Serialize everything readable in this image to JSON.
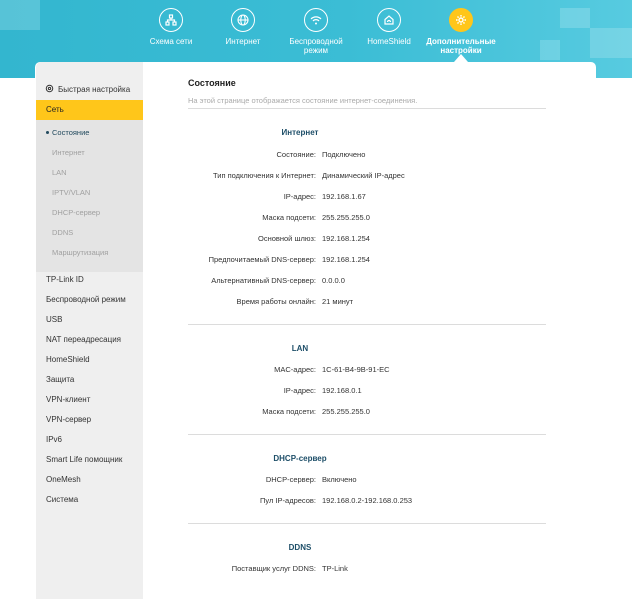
{
  "topnav": {
    "items": [
      {
        "label": "Схема сети",
        "icon": "network-map-icon"
      },
      {
        "label": "Интернет",
        "icon": "globe-icon"
      },
      {
        "label": "Беспроводной режим",
        "icon": "wifi-icon"
      },
      {
        "label": "HomeShield",
        "icon": "homeshield-icon"
      },
      {
        "label": "Дополнительные настройки",
        "icon": "gear-icon"
      }
    ],
    "active_index": 4
  },
  "sidebar": {
    "quick_setup": "Быстрая настройка",
    "network": "Сеть",
    "network_sub": [
      "Состояние",
      "Интернет",
      "LAN",
      "IPTV/VLAN",
      "DHCP-сервер",
      "DDNS",
      "Маршрутизация"
    ],
    "items": [
      "TP-Link ID",
      "Беспроводной режим",
      "USB",
      "NAT переадресация",
      "HomeShield",
      "Защита",
      "VPN-клиент",
      "VPN-сервер",
      "IPv6",
      "Smart Life помощник",
      "OneMesh",
      "Система"
    ]
  },
  "main": {
    "title": "Состояние",
    "description": "На этой странице отображается состояние интернет-соединения.",
    "internet": {
      "title": "Интернет",
      "rows": [
        {
          "label": "Состояние:",
          "value": "Подключено"
        },
        {
          "label": "Тип подключения к Интернет:",
          "value": "Динамический IP-адрес"
        },
        {
          "label": "IP-адрес:",
          "value": "192.168.1.67"
        },
        {
          "label": "Маска подсети:",
          "value": "255.255.255.0"
        },
        {
          "label": "Основной шлюз:",
          "value": "192.168.1.254"
        },
        {
          "label": "Предпочитаемый DNS-сервер:",
          "value": "192.168.1.254"
        },
        {
          "label": "Альтернативный DNS-сервер:",
          "value": "0.0.0.0"
        },
        {
          "label": "Время работы онлайн:",
          "value": "21 минут"
        }
      ]
    },
    "lan": {
      "title": "LAN",
      "rows": [
        {
          "label": "MAC-адрес:",
          "value": "1C-61-B4-9B-91-EC"
        },
        {
          "label": "IP-адрес:",
          "value": "192.168.0.1"
        },
        {
          "label": "Маска подсети:",
          "value": "255.255.255.0"
        }
      ]
    },
    "dhcp": {
      "title": "DHCP-сервер",
      "rows": [
        {
          "label": "DHCP-сервер:",
          "value": "Включено"
        },
        {
          "label": "Пул IP-адресов:",
          "value": "192.168.0.2-192.168.0.253"
        }
      ]
    },
    "ddns": {
      "title": "DDNS",
      "rows": [
        {
          "label": "Поставщик услуг DDNS:",
          "value": "TP-Link"
        }
      ]
    }
  },
  "colors": {
    "banner": "#3bbdd5",
    "accent": "#ffc61a",
    "section_title": "#1d4e68"
  }
}
